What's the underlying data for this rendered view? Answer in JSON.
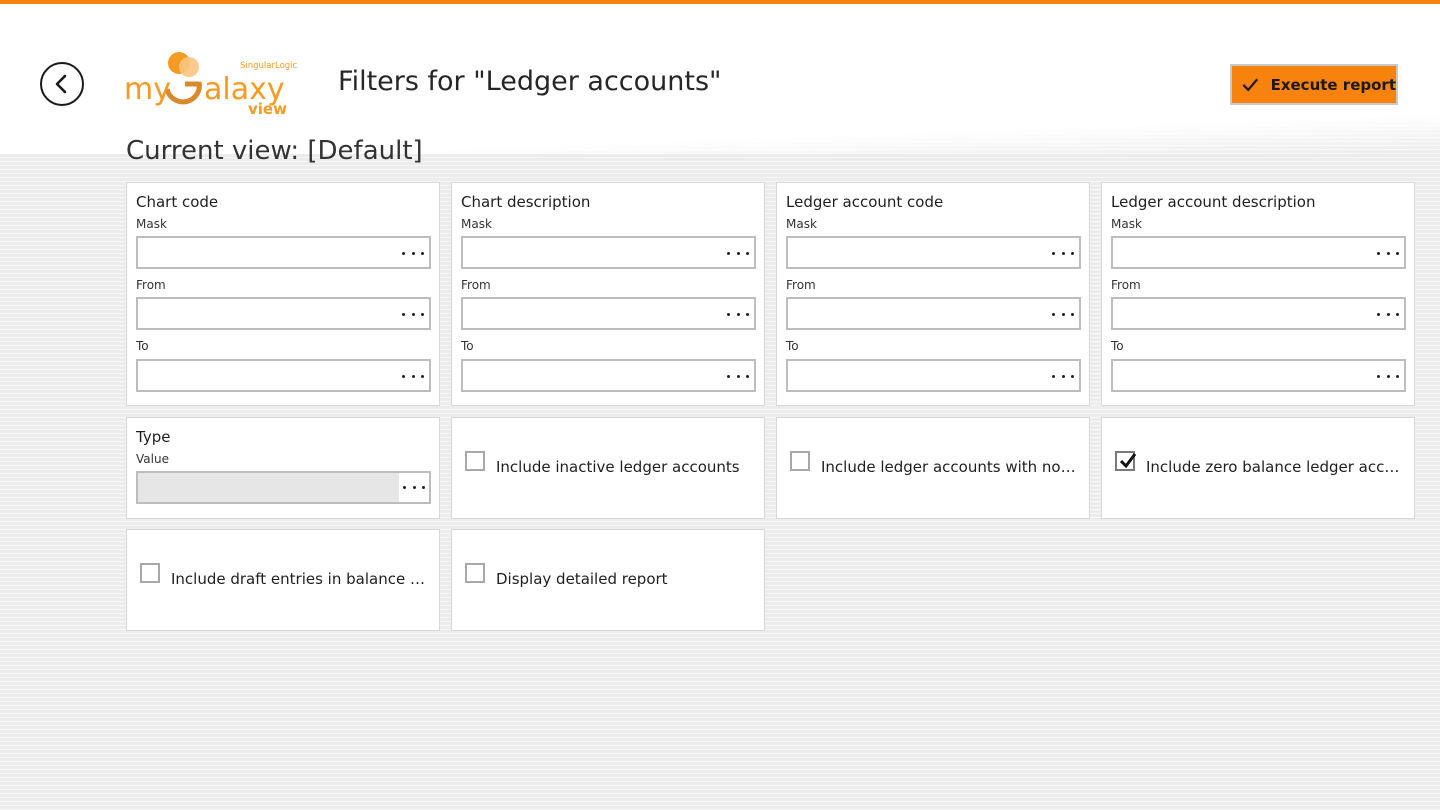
{
  "header": {
    "page_title": "Filters for \"Ledger accounts\"",
    "execute_label": "Execute report",
    "logo": {
      "brand_my": "my",
      "brand_alaxy": "alaxy",
      "brand_view": "view",
      "brand_company": "SingularLogic"
    }
  },
  "current_view": "Current view: [Default]",
  "range_filters": [
    {
      "title": "Chart code",
      "mask_label": "Mask",
      "from_label": "From",
      "to_label": "To",
      "mask_value": "",
      "from_value": "",
      "to_value": ""
    },
    {
      "title": "Chart description",
      "mask_label": "Mask",
      "from_label": "From",
      "to_label": "To",
      "mask_value": "",
      "from_value": "",
      "to_value": ""
    },
    {
      "title": "Ledger account code",
      "mask_label": "Mask",
      "from_label": "From",
      "to_label": "To",
      "mask_value": "",
      "from_value": "",
      "to_value": ""
    },
    {
      "title": "Ledger account description",
      "mask_label": "Mask",
      "from_label": "From",
      "to_label": "To",
      "mask_value": "",
      "from_value": "",
      "to_value": ""
    }
  ],
  "type_filter": {
    "title": "Type",
    "value_label": "Value",
    "value": ""
  },
  "checkboxes": [
    {
      "label": "Include inactive ledger accounts",
      "checked": false
    },
    {
      "label": "Include ledger accounts with no tr...",
      "checked": false
    },
    {
      "label": "Include zero balance ledger accou...",
      "checked": true
    },
    {
      "label": "Include draft entries in balance cal...",
      "checked": false
    },
    {
      "label": "Display detailed report",
      "checked": false
    }
  ],
  "colors": {
    "accent": "#f7820d",
    "logo_orange": "#f59a23",
    "text": "#1f1f1f",
    "field_border": "#bdbdbd"
  },
  "icons": {
    "back": "back-arrow-icon",
    "execute": "check-icon",
    "field_picker": "ellipsis-icon"
  }
}
